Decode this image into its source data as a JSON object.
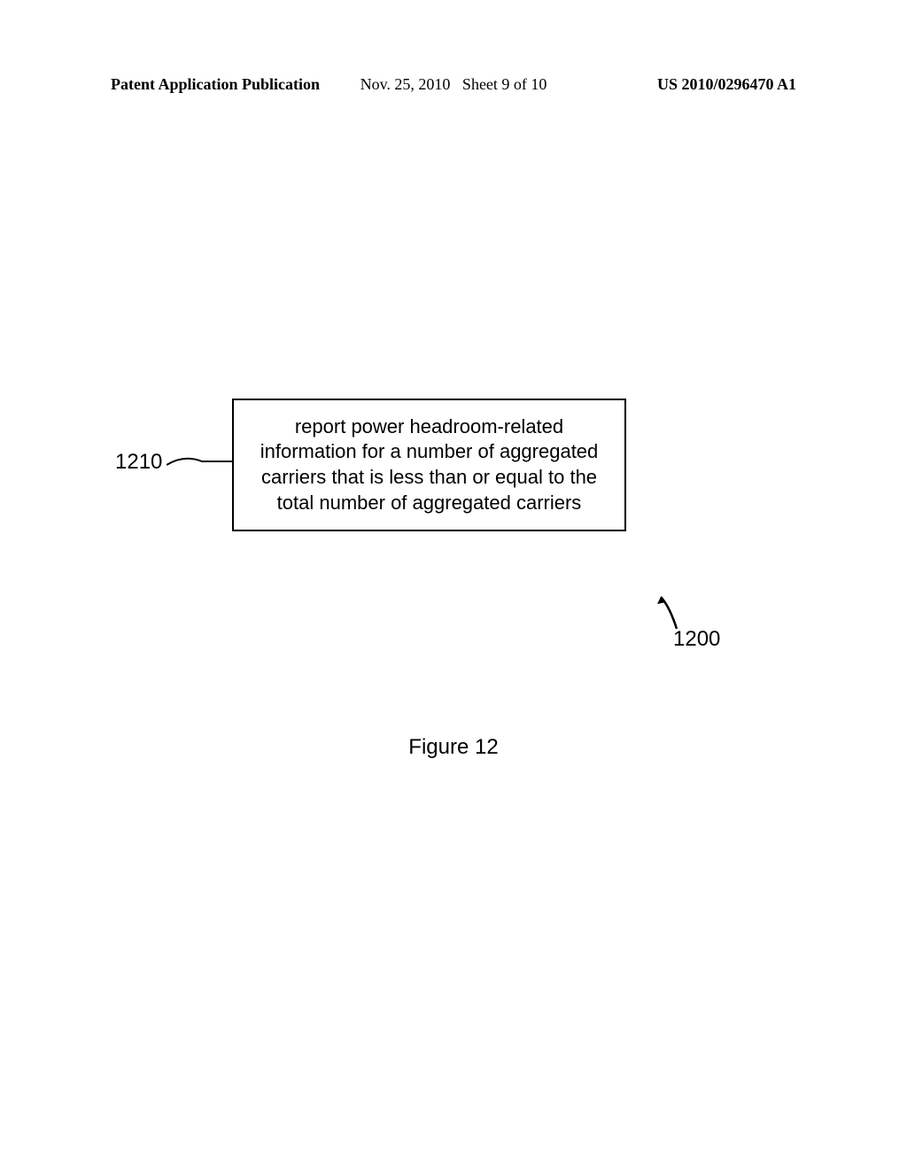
{
  "header": {
    "left": "Patent Application Publication",
    "date": "Nov. 25, 2010",
    "sheet": "Sheet 9 of 10",
    "pubnum": "US 2010/0296470 A1"
  },
  "diagram": {
    "ref_1210": "1210",
    "box_text": "report power headroom-related information for a number of aggregated carriers that is less than or equal to the total number of aggregated carriers",
    "ref_1200": "1200",
    "figure_caption": "Figure 12"
  }
}
